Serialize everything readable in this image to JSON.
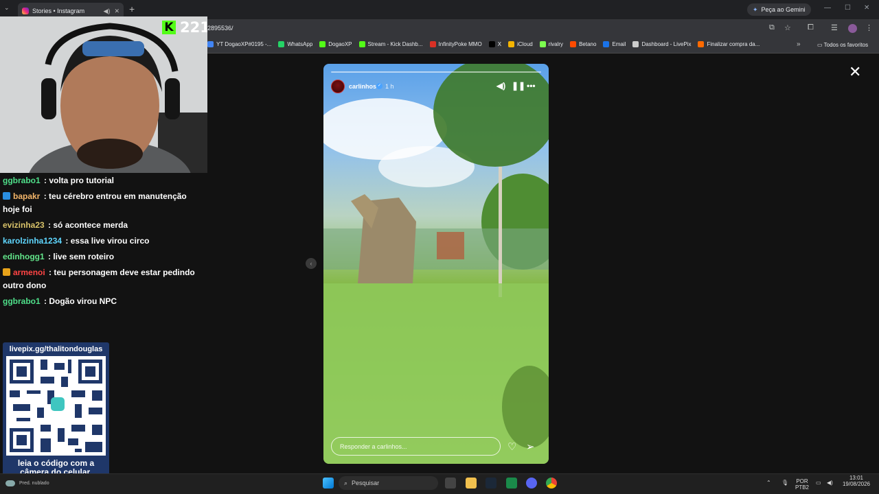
{
  "browser": {
    "tab_title": "Stories • Instagram",
    "url": "2895536/",
    "gemini_label": "Peça ao Gemini",
    "bookmarks": [
      {
        "label": "YT DogaoXP#0195 -...",
        "color": "#4285f4"
      },
      {
        "label": "WhatsApp",
        "color": "#25d366"
      },
      {
        "label": "DogaoXP",
        "color": "#53fc18"
      },
      {
        "label": "Stream - Kick Dashb...",
        "color": "#53fc18"
      },
      {
        "label": "InfinityPoke MMO",
        "color": "#d93025"
      },
      {
        "label": "X",
        "color": "#000000"
      },
      {
        "label": "iCloud",
        "color": "#f4b400"
      },
      {
        "label": "rivalry",
        "color": "#7cff4f"
      },
      {
        "label": "Betano",
        "color": "#ff4b00"
      },
      {
        "label": "Email",
        "color": "#1a73e8"
      },
      {
        "label": "Dashboard - LivePix",
        "color": "#cccccc"
      },
      {
        "label": "Finalizar compra da...",
        "color": "#ff6a00"
      }
    ],
    "all_favorites_label": "Todos os favoritos"
  },
  "stream_overlay": {
    "viewer_count": "221",
    "chat": [
      {
        "user": "ggbrabo1",
        "user_color": "#4fe08a",
        "text": "volta pro tutorial",
        "badge": null
      },
      {
        "user": "bapakr",
        "user_color": "#f4b66a",
        "text": "teu cérebro entrou em manutenção hoje foi",
        "badge": "#2a8ee0"
      },
      {
        "user": "evizinha23",
        "user_color": "#d9c36a",
        "text": "só acontece merda",
        "badge": null
      },
      {
        "user": "karolzinha1234",
        "user_color": "#5fd7ff",
        "text": "essa live virou circo",
        "badge": null
      },
      {
        "user": "edinhogg1",
        "user_color": "#62e58a",
        "text": "live sem roteiro",
        "badge": null
      },
      {
        "user": "armenoi",
        "user_color": "#ff4444",
        "text": "teu personagem deve estar pedindo outro dono",
        "badge": "#e8a31a"
      },
      {
        "user": "ggbrabo1",
        "user_color": "#4fe08a",
        "text": "Dogão virou NPC",
        "badge": null
      }
    ],
    "livepix_url": "livepix.gg/thalitondouglas",
    "livepix_caption": "leia o código com a câmera do celular."
  },
  "story": {
    "username": "carlinhos",
    "time_ago": "1 h",
    "reply_placeholder": "Responder a carlinhos...",
    "progress": 0.0
  },
  "taskbar": {
    "weather": "Pred. nublado",
    "search_placeholder": "Pesquisar",
    "lang": "POR",
    "lang2": "PTB2",
    "time": "13:01",
    "date": "19/08/2026"
  }
}
